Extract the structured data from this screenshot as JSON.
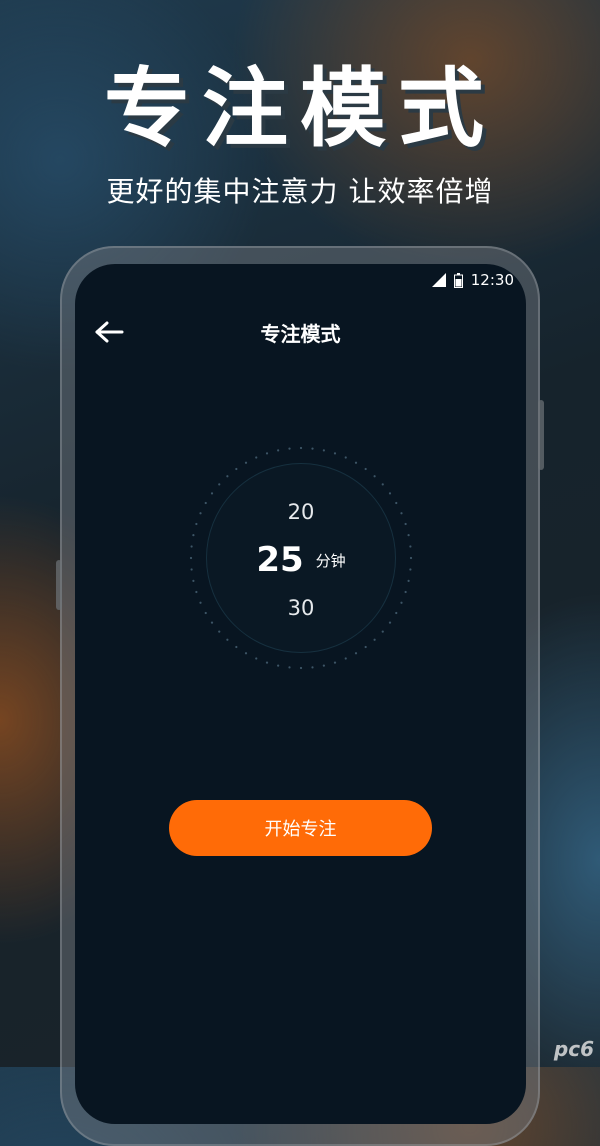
{
  "hero": {
    "title": "专注模式",
    "subtitle": "更好的集中注意力 让效率倍增"
  },
  "status_bar": {
    "time": "12:30",
    "icons": [
      "signal-icon",
      "battery-icon"
    ]
  },
  "app_bar": {
    "back_icon": "arrow-left-icon",
    "title": "专注模式"
  },
  "timer": {
    "previous_option": "20",
    "current_value": "25",
    "unit": "分钟",
    "next_option": "30"
  },
  "actions": {
    "start_label": "开始专注"
  },
  "watermark": "pc6",
  "colors": {
    "accent": "#ff6b07",
    "screen_bg": "#081521",
    "text": "#ffffff"
  }
}
